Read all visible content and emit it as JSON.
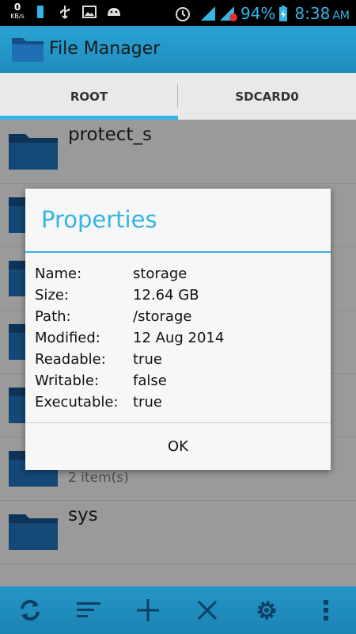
{
  "status_bar": {
    "speed_value": "0",
    "speed_unit": "KB/s",
    "battery_percent": "94%",
    "time": "8:38",
    "ampm": "AM"
  },
  "action_bar": {
    "title": "File Manager",
    "icon": "folder-icon"
  },
  "tabs": [
    {
      "label": "ROOT",
      "selected": true
    },
    {
      "label": "SDCARD0",
      "selected": false
    }
  ],
  "files": [
    {
      "name": "protect_s",
      "sub": ""
    },
    {
      "name": "",
      "sub": ""
    },
    {
      "name": "",
      "sub": ""
    },
    {
      "name": "",
      "sub": ""
    },
    {
      "name": "",
      "sub": ""
    },
    {
      "name": "",
      "sub": "2 item(s)"
    },
    {
      "name": "sys",
      "sub": ""
    }
  ],
  "dialog": {
    "title": "Properties",
    "properties": [
      {
        "key": "Name:",
        "value": "storage"
      },
      {
        "key": "Size:",
        "value": "12.64 GB"
      },
      {
        "key": "Path:",
        "value": "/storage"
      },
      {
        "key": "Modified:",
        "value": "12 Aug 2014"
      },
      {
        "key": "Readable:",
        "value": "true"
      },
      {
        "key": "Writable:",
        "value": "false"
      },
      {
        "key": "Executable:",
        "value": "true"
      }
    ],
    "ok_label": "OK"
  },
  "bottom_bar": {
    "buttons": [
      "refresh-icon",
      "sort-icon",
      "add-icon",
      "close-icon",
      "settings-icon",
      "overflow-menu-icon"
    ]
  },
  "colors": {
    "accent": "#33b5e5",
    "action_bar": "#2196c8",
    "folder": "#1f6fb5"
  }
}
